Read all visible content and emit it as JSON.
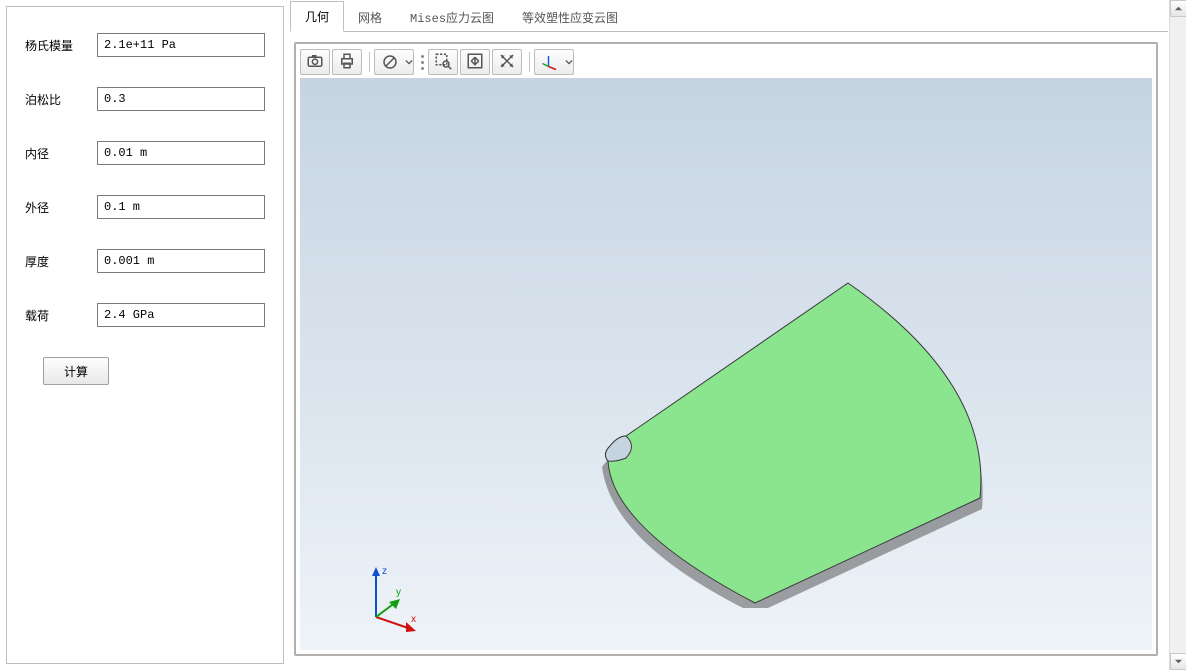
{
  "panel": {
    "fields": [
      {
        "label": "杨氏模量",
        "value": "2.1e+11 Pa"
      },
      {
        "label": "泊松比",
        "value": "0.3"
      },
      {
        "label": "内径",
        "value": "0.01 m"
      },
      {
        "label": "外径",
        "value": "0.1 m"
      },
      {
        "label": "厚度",
        "value": "0.001 m"
      },
      {
        "label": "载荷",
        "value": "2.4 GPa"
      }
    ],
    "compute_label": "计算"
  },
  "tabs": [
    {
      "label": "几何",
      "active": true
    },
    {
      "label": "网格",
      "active": false
    },
    {
      "label": "Mises应力云图",
      "active": false
    },
    {
      "label": "等效塑性应变云图",
      "active": false
    }
  ],
  "toolbar": {
    "camera": "camera-icon",
    "print": "print-icon",
    "deny": "no-entry-icon",
    "zoombox": "zoom-box-icon",
    "fit": "fit-view-icon",
    "pan": "cross-arrows-icon",
    "axes": "axis-triad-icon"
  },
  "viewport": {
    "shape_color": "#8be58f",
    "axes": {
      "x": "x",
      "y": "y",
      "z": "z"
    }
  }
}
